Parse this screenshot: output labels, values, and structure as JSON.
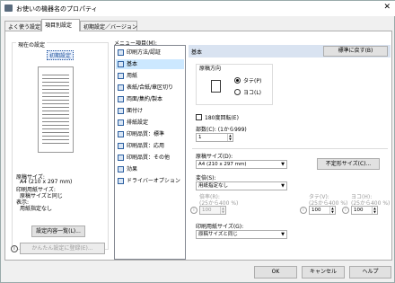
{
  "window": {
    "title": "お使いの機器名のプロパティ",
    "close_glyph": "✕"
  },
  "tabs": [
    {
      "label": "よく使う設定",
      "active": false
    },
    {
      "label": "項目別設定",
      "active": true
    },
    {
      "label": "初期設定／バージョン",
      "active": false
    }
  ],
  "left": {
    "current_label": "現在の設定",
    "current_value": "初期設定",
    "summary": {
      "paper_size_label": "原稿サイズ:",
      "paper_size_value": "A4 (210 x 297 mm)",
      "print_paper_label": "印刷用紙サイズ:",
      "print_paper_value": "原稿サイズと同じ",
      "color_label": "表示:",
      "color_value": "用紙指定なし"
    },
    "list_button": "設定内容一覧(L)...",
    "register_button": "かんたん設定に登録(E)..."
  },
  "menu": {
    "label": "メニュー項目(M):",
    "items": [
      "印刷方法/認証",
      "基本",
      "用紙",
      "表紙/合紙/章区切り",
      "両面/集約/製本",
      "面付け",
      "排紙設定",
      "印刷品質：標準",
      "印刷品質：応用",
      "印刷品質：その他",
      "効果",
      "ドライバーオプション"
    ],
    "selected_index": 1
  },
  "right": {
    "header": "基本",
    "restore_button": "標準に戻す(B)",
    "orientation": {
      "label": "原稿方向",
      "portrait": "タテ(P)",
      "landscape": "ヨコ(L)",
      "selected": "portrait"
    },
    "rotate180": {
      "label": "180度回転(E)",
      "checked": false
    },
    "copies": {
      "label": "部数(C): (1から999)",
      "value": "1"
    },
    "paper_size": {
      "label": "原稿サイズ(D):",
      "value": "A4 (210 x 297 mm)",
      "custom_button": "不定形サイズ(C)..."
    },
    "scale": {
      "label": "変倍(S):",
      "value": "用紙指定なし"
    },
    "ratio": {
      "label": "倍率(R):",
      "range": "(25から400 %)",
      "value": "100"
    },
    "vertical": {
      "label": "タテ(V):",
      "range": "(25から400 %)",
      "value": "100"
    },
    "horizontal": {
      "label": "ヨコ(H):",
      "range": "(25から400 %)",
      "value": "100"
    },
    "print_paper": {
      "label": "印刷用紙サイズ(G):",
      "value": "原稿サイズと同じ"
    }
  },
  "footer": {
    "ok": "OK",
    "cancel": "キャンセル",
    "help": "ヘルプ"
  },
  "colors": {
    "accent": "#0078d7",
    "header_bg": "#d9e3f1",
    "selected_bg": "#cce8ff"
  }
}
